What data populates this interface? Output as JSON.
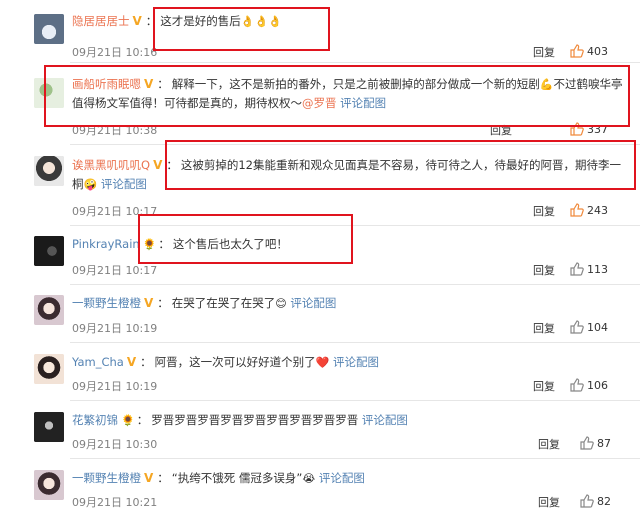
{
  "comments": [
    {
      "username": "隐居居居士",
      "badge": "V",
      "text": "这才是好的售后",
      "emoji": "👌👌👌",
      "time": "09月21日 10:16",
      "reply": "回复",
      "likes": "403"
    },
    {
      "username": "画船听雨眠嗯",
      "badge": "V",
      "text": "解释一下，这不是新拍的番外，只是之前被删掉的部分做成一个新的短剧",
      "emoji": "💪",
      "text2": "不过鹤唳华亭值得杨文军值得！可待都是真的，期待权权～",
      "mention": "@罗晋",
      "link": "评论配图",
      "time": "09月21日 10:38",
      "reply": "回复",
      "likes": "337"
    },
    {
      "username": "诶黑黑叽叽叽Q",
      "badge": "V",
      "text": "这被剪掉的12集能重新和观众见面真是不容易，待可待之人，待最好的阿晋，期待李一桐",
      "emoji": "🤪",
      "link": "评论配图",
      "time": "09月21日 10:17",
      "reply": "回复",
      "likes": "243"
    },
    {
      "username": "PinkrayRain",
      "badge": "🌻",
      "text": "这个售后也太久了吧！",
      "time": "09月21日 10:17",
      "reply": "回复",
      "likes": "113"
    },
    {
      "username": "一颗野生橙橙",
      "badge": "V",
      "text": "在哭了在哭了在哭了",
      "emoji": "😊",
      "link": "评论配图",
      "time": "09月21日 10:19",
      "reply": "回复",
      "likes": "104"
    },
    {
      "username": "Yam_Cha",
      "badge": "V",
      "text": "阿晋，这一次可以好好道个别了",
      "emoji": "❤️",
      "link": "评论配图",
      "time": "09月21日 10:19",
      "reply": "回复",
      "likes": "106"
    },
    {
      "username": "花繁初锦",
      "badge": "🌻",
      "text": "罗晋罗晋罗晋罗晋罗晋罗晋罗晋罗晋罗晋",
      "link": "评论配图",
      "time": "09月21日 10:30",
      "reply": "回复",
      "likes": "87"
    },
    {
      "username": "一颗野生橙橙",
      "badge": "V",
      "text": "“执绔不饿死 儒冠多误身”",
      "emoji": "😭",
      "link": "评论配图",
      "time": "09月21日 10:21",
      "reply": "回复",
      "likes": "82"
    }
  ],
  "colors": {
    "username": "#eb7350",
    "link": "#5583b3",
    "highlight_box": "#e0141e"
  }
}
